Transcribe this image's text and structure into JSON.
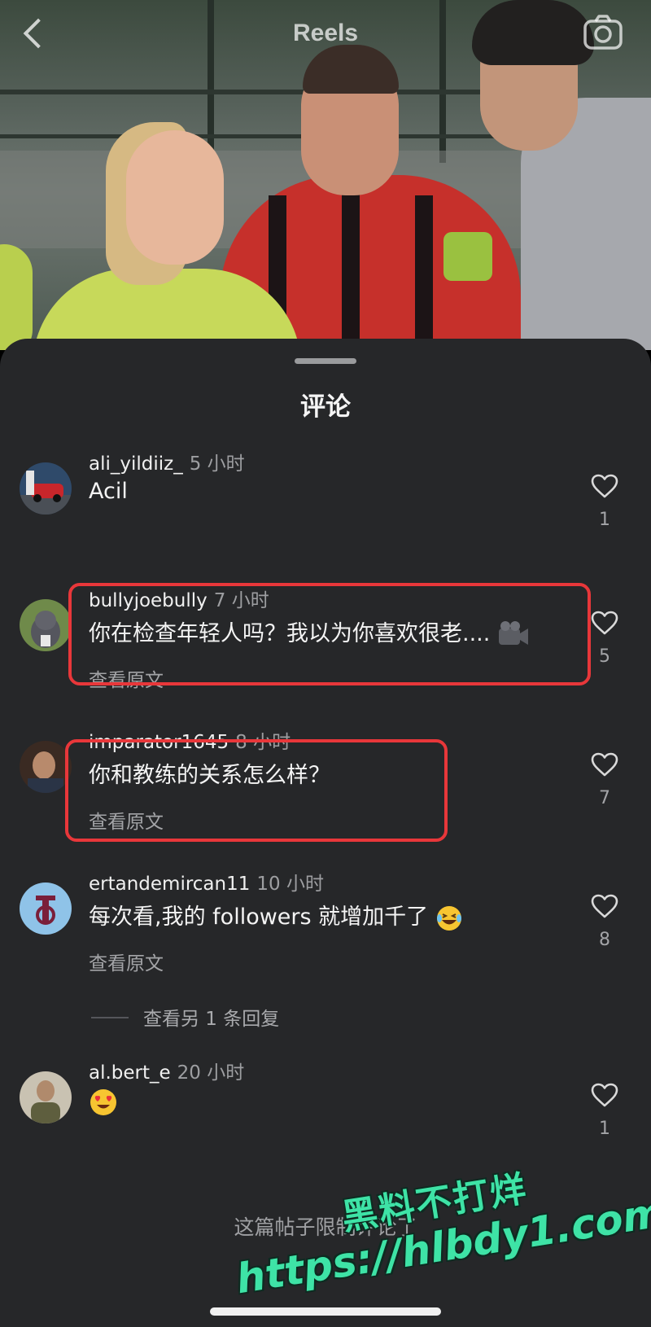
{
  "header": {
    "title": "Reels"
  },
  "sheet": {
    "title": "评论"
  },
  "comments": [
    {
      "username": "ali_yildiiz_",
      "time": "5 小时",
      "text": "Acil",
      "translate": "",
      "likes": "1"
    },
    {
      "username": "bullyjoebully",
      "time": "7 小时",
      "text": "你在检查年轻人吗？我以为你喜欢很老....",
      "translate": "查看原文",
      "likes": "5"
    },
    {
      "username": "imparator1645",
      "time": "8 小时",
      "text": "你和教练的关系怎么样？",
      "translate": "查看原文",
      "likes": "7"
    },
    {
      "username": "ertandemircan11",
      "time": "10 小时",
      "text": "每次看,我的 followers 就增加千了",
      "translate": "查看原文",
      "likes": "8"
    },
    {
      "username": "al.bert_e",
      "time": "20 小时",
      "text": "",
      "translate": "",
      "likes": "1"
    }
  ],
  "view_replies": "查看另 1 条回复",
  "restricted_notice": "这篇帖子限制评论了",
  "watermark": {
    "line1": "黑料不打烊",
    "line2": "https://hlbdy1.com",
    "color": "#3ee3a6"
  },
  "colors": {
    "sheet_bg": "#262729",
    "highlight": "#e8373a"
  }
}
